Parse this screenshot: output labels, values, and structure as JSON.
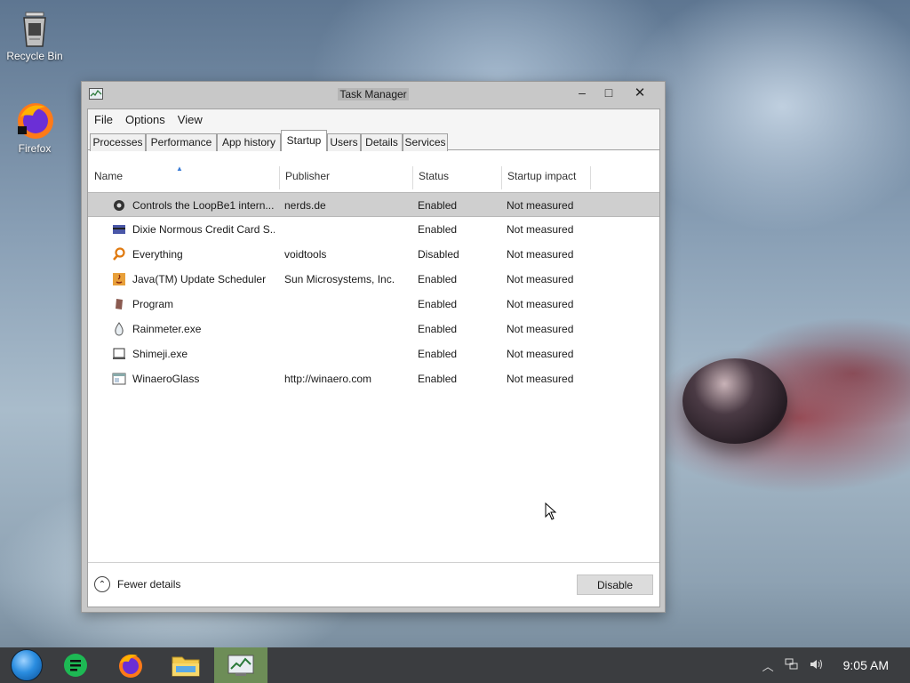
{
  "desktop": {
    "icons": [
      {
        "label": "Recycle Bin",
        "icon": "recycle-bin-icon"
      },
      {
        "label": "Firefox",
        "icon": "firefox-icon"
      }
    ]
  },
  "window": {
    "title": "Task Manager",
    "controls": {
      "minimize": "–",
      "maximize": "□",
      "close": "✕"
    },
    "menu": [
      "File",
      "Options",
      "View"
    ],
    "tabs": [
      {
        "label": "Processes",
        "active": false
      },
      {
        "label": "Performance",
        "active": false
      },
      {
        "label": "App history",
        "active": false
      },
      {
        "label": "Startup",
        "active": true
      },
      {
        "label": "Users",
        "active": false
      },
      {
        "label": "Details",
        "active": false
      },
      {
        "label": "Services",
        "active": false
      }
    ],
    "columns": {
      "name": "Name",
      "publisher": "Publisher",
      "status": "Status",
      "impact": "Startup impact"
    },
    "rows": [
      {
        "name": "Controls the LoopBe1 intern...",
        "publisher": "nerds.de",
        "status": "Enabled",
        "impact": "Not measured",
        "icon": "loopbe-icon",
        "selected": true
      },
      {
        "name": "Dixie Normous Credit Card S...",
        "publisher": "",
        "status": "Enabled",
        "impact": "Not measured",
        "icon": "credit-card-icon",
        "selected": false
      },
      {
        "name": "Everything",
        "publisher": "voidtools",
        "status": "Disabled",
        "impact": "Not measured",
        "icon": "magnifier-icon",
        "selected": false
      },
      {
        "name": "Java(TM) Update Scheduler",
        "publisher": "Sun Microsystems, Inc.",
        "status": "Enabled",
        "impact": "Not measured",
        "icon": "java-icon",
        "selected": false
      },
      {
        "name": "Program",
        "publisher": "",
        "status": "Enabled",
        "impact": "Not measured",
        "icon": "program-icon",
        "selected": false
      },
      {
        "name": "Rainmeter.exe",
        "publisher": "",
        "status": "Enabled",
        "impact": "Not measured",
        "icon": "rainmeter-drop-icon",
        "selected": false
      },
      {
        "name": "Shimeji.exe",
        "publisher": "",
        "status": "Enabled",
        "impact": "Not measured",
        "icon": "shimeji-icon",
        "selected": false
      },
      {
        "name": "WinaeroGlass",
        "publisher": "http://winaero.com",
        "status": "Enabled",
        "impact": "Not measured",
        "icon": "winaero-icon",
        "selected": false
      }
    ],
    "footer": {
      "fewer_details": "Fewer details",
      "disable_button": "Disable"
    }
  },
  "taskbar": {
    "items": [
      "start-orb-icon",
      "notes-app-icon",
      "firefox-icon",
      "file-explorer-icon",
      "task-manager-icon"
    ],
    "active_index": 4,
    "tray_icons": [
      "chevron-up-icon",
      "network-icon",
      "volume-icon"
    ],
    "clock": "9:05 AM"
  },
  "colors": {
    "taskbar": "#3b3d40",
    "active_task": "#6d8d57",
    "selection": "#cfcfcf"
  }
}
